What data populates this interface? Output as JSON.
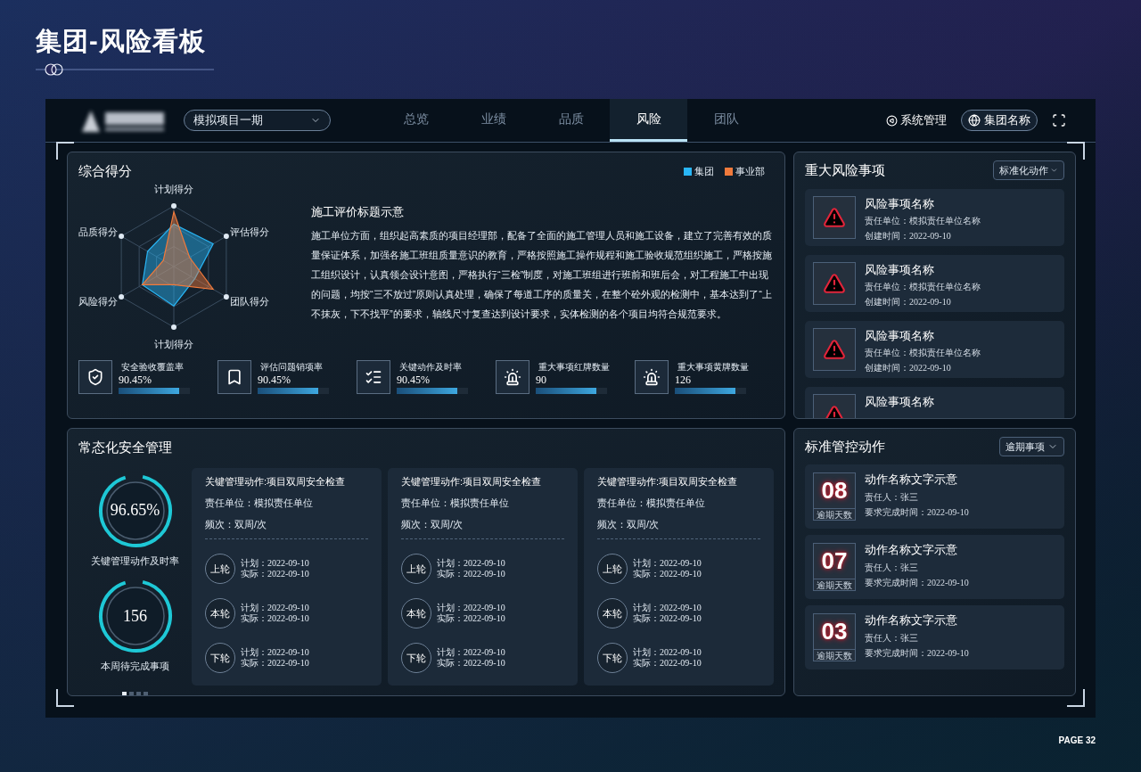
{
  "page": {
    "title": "集团-风险看板",
    "page_number": "PAGE 32"
  },
  "header": {
    "project_select": "模拟项目一期",
    "tabs": [
      {
        "label": "总览",
        "selected": false
      },
      {
        "label": "业绩",
        "selected": false
      },
      {
        "label": "品质",
        "selected": false
      },
      {
        "label": "风险",
        "selected": true
      },
      {
        "label": "团队",
        "selected": false
      }
    ],
    "system_link": "系统管理",
    "org_button": "集团名称"
  },
  "score_panel": {
    "title": "综合得分",
    "legend": [
      {
        "label": "集团",
        "color": "#29b6f6"
      },
      {
        "label": "事业部",
        "color": "#f07a3c"
      }
    ],
    "radar_axes": [
      "计划得分",
      "评估得分",
      "团队得分",
      "计划得分",
      "风险得分",
      "品质得分"
    ],
    "article": {
      "title": "施工评价标题示意",
      "body": "施工单位方面，组织起高素质的项目经理部，配备了全面的施工管理人员和施工设备，建立了完善有效的质量保证体系，加强各施工班组质量意识的教育，严格按照施工操作规程和施工验收规范组织施工，严格按施工组织设计，认真领会设计意图，严格执行“三检”制度，对施工班组进行班前和班后会，对工程施工中出现的问题，均按“三不放过”原则认真处理，确保了每道工序的质量关，在整个砼外观的检测中，基本达到了“上不抹灰，下不找平”的要求，轴线尺寸复查达到设计要求，实体检测的各个项目均符合规范要求。"
    },
    "kpis": [
      {
        "kind": "shield",
        "label": "安全验收覆盖率",
        "value": "90.45%",
        "level": 0.85
      },
      {
        "kind": "bookmark",
        "label": "评估问题销项率",
        "value": "90.45%",
        "level": 0.85
      },
      {
        "kind": "checklist",
        "label": "关键动作及时率",
        "value": "90.45%",
        "level": 0.85
      },
      {
        "kind": "siren",
        "label": "重大事项红牌数量",
        "value": "90",
        "level": 0.85
      },
      {
        "kind": "siren",
        "label": "重大事项黄牌数量",
        "value": "126",
        "level": 0.85
      }
    ]
  },
  "safety_panel": {
    "title": "常态化安全管理",
    "rings": [
      {
        "value": "96.65%",
        "label": "关键管理动作及时率"
      },
      {
        "value": "156",
        "label": "本周待完成事项"
      }
    ],
    "pager": [
      {
        "selected": true
      },
      {
        "selected": false
      },
      {
        "selected": false
      },
      {
        "selected": false
      }
    ],
    "cards": [
      {
        "action": "关键管理动作:项目双周安全检查",
        "unit": "责任单位：模拟责任单位",
        "frequency": "频次：双周/次",
        "rounds": [
          {
            "badge": "上轮",
            "plan": "计划：2022-09-10",
            "actual": "实际：2022-09-10"
          },
          {
            "badge": "本轮",
            "plan": "计划：2022-09-10",
            "actual": "实际：2022-09-10"
          },
          {
            "badge": "下轮",
            "plan": "计划：2022-09-10",
            "actual": "实际：2022-09-10"
          }
        ]
      },
      {
        "action": "关键管理动作:项目双周安全检查",
        "unit": "责任单位：模拟责任单位",
        "frequency": "频次：双周/次",
        "rounds": [
          {
            "badge": "上轮",
            "plan": "计划：2022-09-10",
            "actual": "实际：2022-09-10"
          },
          {
            "badge": "本轮",
            "plan": "计划：2022-09-10",
            "actual": "实际：2022-09-10"
          },
          {
            "badge": "下轮",
            "plan": "计划：2022-09-10",
            "actual": "实际：2022-09-10"
          }
        ]
      },
      {
        "action": "关键管理动作:项目双周安全检查",
        "unit": "责任单位：模拟责任单位",
        "frequency": "频次：双周/次",
        "rounds": [
          {
            "badge": "上轮",
            "plan": "计划：2022-09-10",
            "actual": "实际：2022-09-10"
          },
          {
            "badge": "本轮",
            "plan": "计划：2022-09-10",
            "actual": "实际：2022-09-10"
          },
          {
            "badge": "下轮",
            "plan": "计划：2022-09-10",
            "actual": "实际：2022-09-10"
          }
        ]
      }
    ]
  },
  "risk_panel": {
    "title": "重大风险事项",
    "filter": "标准化动作",
    "items": [
      {
        "name": "风险事项名称",
        "unit": "责任单位：模拟责任单位名称",
        "created": "创建时间：2022-09-10"
      },
      {
        "name": "风险事项名称",
        "unit": "责任单位：模拟责任单位名称",
        "created": "创建时间：2022-09-10"
      },
      {
        "name": "风险事项名称",
        "unit": "责任单位：模拟责任单位名称",
        "created": "创建时间：2022-09-10"
      },
      {
        "name": "风险事项名称"
      }
    ]
  },
  "control_panel": {
    "title": "标准管控动作",
    "filter": "逾期事项",
    "items": [
      {
        "days": "08",
        "days_label": "逾期天数",
        "name": "动作名称文字示意",
        "owner": "责任人：张三",
        "due": "要求完成时间：2022-09-10"
      },
      {
        "days": "07",
        "days_label": "逾期天数",
        "name": "动作名称文字示意",
        "owner": "责任人：张三",
        "due": "要求完成时间：2022-09-10"
      },
      {
        "days": "03",
        "days_label": "逾期天数",
        "name": "动作名称文字示意",
        "owner": "责任人：张三",
        "due": "要求完成时间：2022-09-10"
      }
    ]
  }
}
